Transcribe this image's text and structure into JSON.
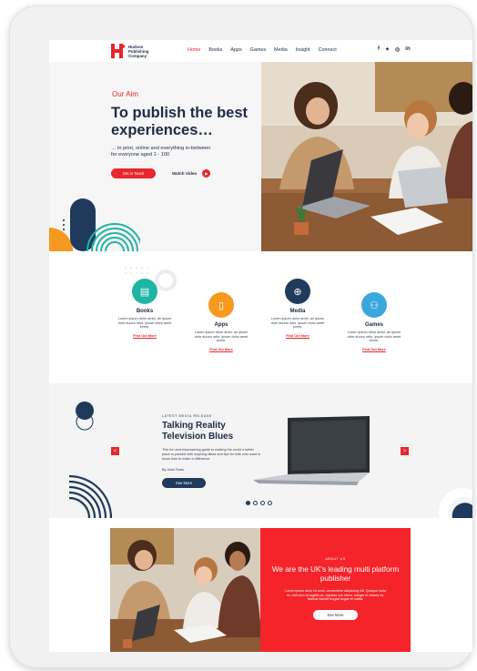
{
  "brand": {
    "name_line1": "Hudson",
    "name_line2": "Publishing",
    "name_line3": "Company",
    "red": "#e8262b",
    "navy": "#1f2a44"
  },
  "nav": {
    "items": [
      "Home",
      "Books",
      "Apps",
      "Games",
      "Media",
      "Insight",
      "Connect"
    ]
  },
  "social": {
    "facebook": "f",
    "twitter": "✦",
    "instagram": "◎",
    "linkedin": "in"
  },
  "hero": {
    "kicker": "Our Aim",
    "title": "To publish the best experiences…",
    "subtitle": "… in print, online and everything in-between for everyone aged 1 - 100",
    "cta_label": "Get in Touch",
    "video_label": "Watch Video"
  },
  "services": [
    {
      "title": "Books",
      "desc": "Lorem ipsum dolor amet, an ipsum dore duuno ortis. ipsum dolor amet lorem.",
      "link": "Find Out More",
      "color": "#1fb5a5",
      "icon": "book-icon"
    },
    {
      "title": "Apps",
      "desc": "Lorem ipsum dolor amet, an ipsum dore duuno ortis. ipsum dolor amet lorem.",
      "link": "Find Out More",
      "color": "#f59a1f",
      "icon": "app-icon"
    },
    {
      "title": "Media",
      "desc": "Lorem ipsum dolor amet, an ipsum dore duuno ortis. ipsum dolor amet lorem.",
      "link": "Find Out More",
      "color": "#1f3a5b",
      "icon": "globe-icon"
    },
    {
      "title": "Games",
      "desc": "Lorem ipsum dolor amet, an ipsum dore duuno ortis. ipsum dolor amet lorem.",
      "link": "Find Out More",
      "color": "#3aa8dd",
      "icon": "gamepad-icon"
    }
  ],
  "release": {
    "kicker": "LATEST MEDIA RELEASE",
    "title": "Talking Reality Television Blues",
    "desc": "This fun and empowering guide to making the world a better place is packed with inspiring ideas and tips for kids who want to know how to make a difference.",
    "author": "By Joan Toms",
    "cta_label": "See More",
    "prev": "<",
    "next": ">"
  },
  "about": {
    "kicker": "ABOUT US",
    "title": "We are the UK's leading multi platform publisher",
    "body": "Lorem ipsum dolor sit amet, consectetur adipiscing elit. Quisque nulla ex, interdum at sagittis ac, egestas non libero. Integer id ultrices mi, facilisis blandit feugiat augue et mattis.",
    "cta_label": "See More"
  }
}
